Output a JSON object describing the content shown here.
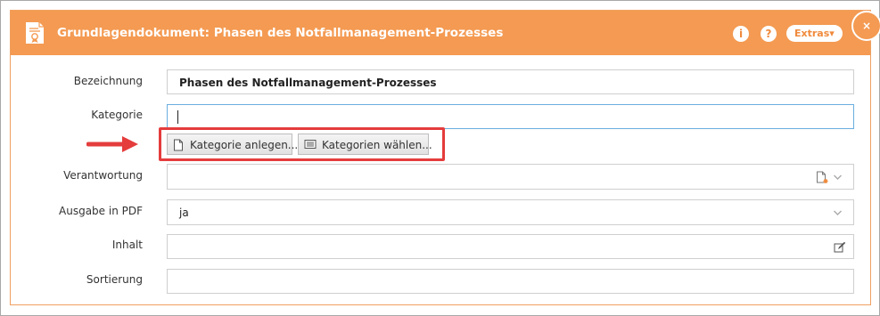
{
  "dialog": {
    "title": "Grundlagendokument: Phasen des Notfallmanagement-Prozesses",
    "info_label": "i",
    "help_label": "?",
    "extras_label": "Extras▾",
    "close_label": "×"
  },
  "form": {
    "bezeichnung": {
      "label": "Bezeichnung",
      "value": "Phasen des Notfallmanagement-Prozesses"
    },
    "kategorie": {
      "label": "Kategorie",
      "value": ""
    },
    "buttons": {
      "create_label": "Kategorie anlegen...",
      "choose_label": "Kategorien wählen..."
    },
    "verantwortung": {
      "label": "Verantwortung",
      "value": ""
    },
    "ausgabe_pdf": {
      "label": "Ausgabe in PDF",
      "value": "ja"
    },
    "inhalt": {
      "label": "Inhalt",
      "value": ""
    },
    "sortierung": {
      "label": "Sortierung",
      "value": ""
    }
  },
  "colors": {
    "titlebar": "#f49a52",
    "highlight": "#e53c3c",
    "focus_border": "#6aaede"
  },
  "icons": [
    "document-certificate-icon",
    "info-icon",
    "help-icon",
    "close-icon",
    "new-document-icon",
    "list-icon",
    "new-document-orange-icon",
    "chevron-down-icon",
    "edit-icon",
    "arrow-right-icon"
  ]
}
